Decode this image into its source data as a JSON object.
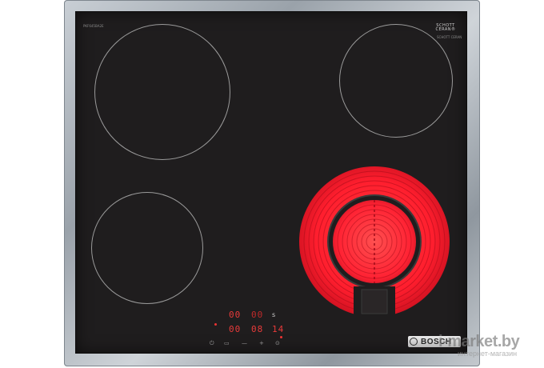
{
  "product": {
    "brand": "BOSCH",
    "glass_brand_line1": "SCHOTT",
    "glass_brand_line2": "CERAN®",
    "glass_small_print": "SCHOTT CERAN",
    "serial_small": "PKF645BA2E"
  },
  "controls": {
    "display_row1_left": "00",
    "display_row1_mid": "00",
    "display_row1_right": "s",
    "display_row2_left": "00",
    "display_row2_mid": "08",
    "display_row2_right": "14",
    "touch_symbols": [
      "⏻",
      "▭",
      "—",
      "+",
      "⊙"
    ],
    "active_zone": "rear-right"
  },
  "watermark": {
    "site": "i-market.by",
    "subtitle": "интернет-магазин"
  },
  "colors": {
    "glass": "#1f1d1e",
    "frame": "#9aa2aa",
    "heating_red": "#ff1e2e",
    "display_red": "#e83a3a"
  }
}
